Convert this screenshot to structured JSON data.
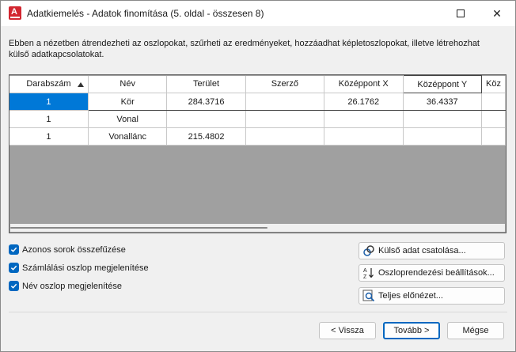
{
  "window": {
    "title": "Adatkiemelés - Adatok finomítása (5. oldal - összesen 8)",
    "app_icon_letter": "A",
    "accent": "#0067c0",
    "selection_color": "#0078d7",
    "empty_grid_color": "#a0a0a0"
  },
  "description": "Ebben a nézetben átrendezheti az oszlopokat, szűrheti az eredményeket, hozzáadhat képletoszlopokat, illetve létrehozhat külső adatkapcsolatokat.",
  "table": {
    "columns": [
      "Darabszám",
      "Név",
      "Terület",
      "Szerző",
      "Középpont X",
      "Középpont Y",
      "Köz"
    ],
    "sorted_column": "Darabszám",
    "rows": [
      [
        "1",
        "Kör",
        "284.3716",
        "",
        "26.1762",
        "36.4337",
        ""
      ],
      [
        "1",
        "Vonal",
        "",
        "",
        "",
        "",
        ""
      ],
      [
        "1",
        "Vonallánc",
        "215.4802",
        "",
        "",
        "",
        ""
      ]
    ]
  },
  "options": {
    "merge_rows": {
      "label": "Azonos sorok összefűzése",
      "checked": true
    },
    "show_count": {
      "label": "Számlálási oszlop megjelenítése",
      "checked": true
    },
    "show_name": {
      "label": "Név oszlop megjelenítése",
      "checked": true
    }
  },
  "actions": {
    "link_external": "Külső adat csatolása...",
    "sort_settings": "Oszloprendezési beállítások...",
    "full_preview": "Teljes előnézet..."
  },
  "footer": {
    "back": "< Vissza",
    "next": "Tovább >",
    "cancel": "Mégse"
  }
}
